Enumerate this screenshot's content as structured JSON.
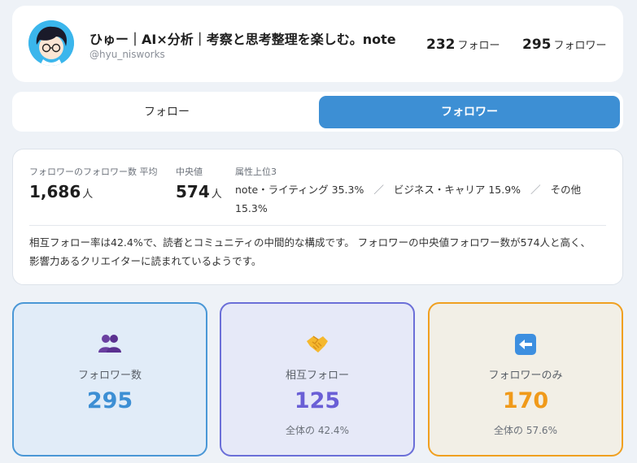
{
  "profile": {
    "name": "ひゅー｜AI×分析｜考察と思考整理を楽しむ。note",
    "handle": "@hyu_nisworks",
    "following_count": "232",
    "following_label": "フォロー",
    "followers_count": "295",
    "followers_label": "フォロワー"
  },
  "tabs": [
    {
      "label": "フォロー",
      "active": false
    },
    {
      "label": "フォロワー",
      "active": true
    }
  ],
  "summary": {
    "avg_label": "フォロワーのフォロワー数 平均",
    "avg_value": "1,686",
    "avg_unit": "人",
    "median_label": "中央値",
    "median_value": "574",
    "median_unit": "人",
    "attr_label": "属性上位3",
    "attributes": [
      "note・ライティング 35.3%",
      "ビジネス・キャリア 15.9%",
      "その他 15.3%"
    ],
    "attr_separator": "／",
    "description": "相互フォロー率は42.4%で、読者とコミュニティの中間的な構成です。 フォロワーの中央値フォロワー数が574人と高く、影響力あるクリエイターに読まれているようです。"
  },
  "metrics": [
    {
      "icon": "people-icon",
      "label": "フォロワー数",
      "value": "295",
      "sub": "",
      "color": "#3d8fd4"
    },
    {
      "icon": "handshake-icon",
      "label": "相互フォロー",
      "value": "125",
      "sub": "全体の 42.4%",
      "color": "#6a5fd6"
    },
    {
      "icon": "left-arrow-icon",
      "label": "フォロワーのみ",
      "value": "170",
      "sub": "全体の 57.6%",
      "color": "#f09a1a"
    }
  ]
}
